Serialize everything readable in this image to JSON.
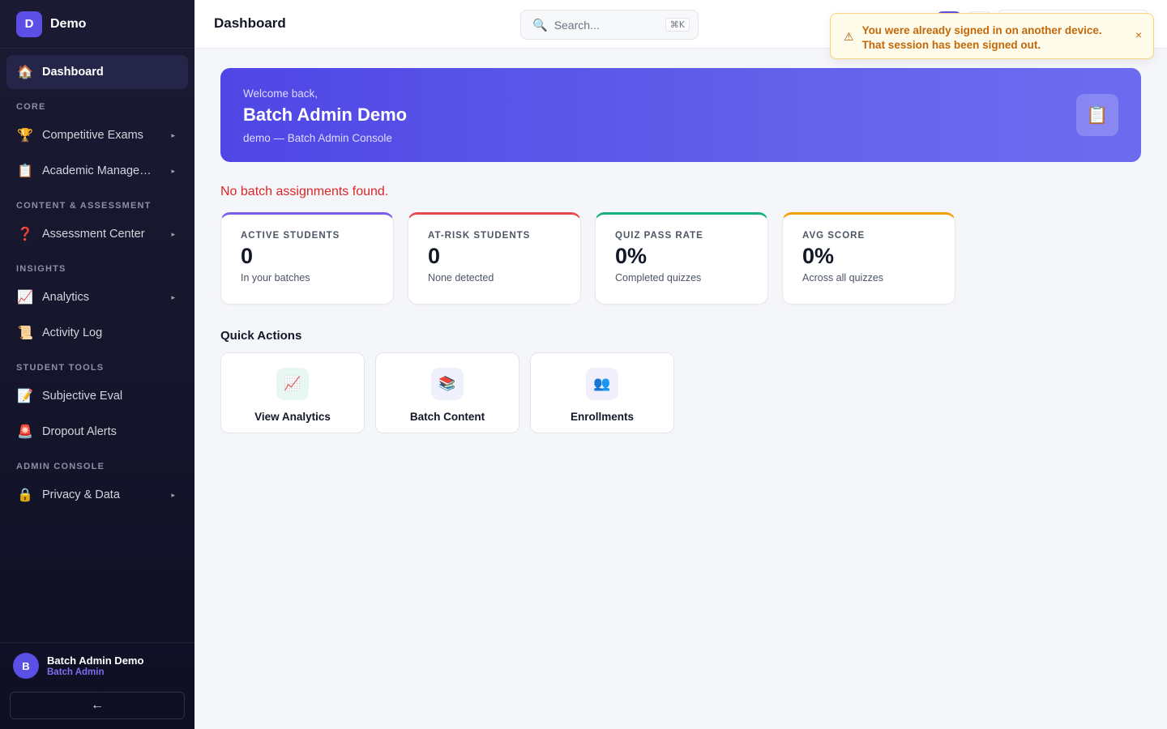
{
  "brand": {
    "logo_letter": "D",
    "name": "Demo"
  },
  "sidebar": {
    "dashboard": {
      "icon": "🏠",
      "label": "Dashboard"
    },
    "sections": {
      "core": "CORE",
      "content": "CONTENT & ASSESSMENT",
      "insights": "INSIGHTS",
      "student_tools": "STUDENT TOOLS",
      "admin_console": "ADMIN CONSOLE"
    },
    "items": {
      "competitive_exams": {
        "icon": "🏆",
        "label": "Competitive Exams"
      },
      "academic_management": {
        "icon": "📋",
        "label": "Academic Management"
      },
      "assessment_center": {
        "icon": "❓",
        "label": "Assessment Center"
      },
      "analytics": {
        "icon": "📈",
        "label": "Analytics"
      },
      "activity_log": {
        "icon": "📜",
        "label": "Activity Log"
      },
      "subjective_eval": {
        "icon": "📝",
        "label": "Subjective Eval"
      },
      "dropout_alerts": {
        "icon": "🚨",
        "label": "Dropout Alerts"
      },
      "privacy_data": {
        "icon": "🔒",
        "label": "Privacy & Data"
      }
    },
    "caret": "▸",
    "user": {
      "initial": "B",
      "name": "Batch Admin Demo",
      "role": "Batch Admin"
    },
    "collapse_icon": "←"
  },
  "header": {
    "title": "Dashboard",
    "search": {
      "icon": "🔍",
      "placeholder": "Search...",
      "shortcut": "⌘K"
    }
  },
  "toast": {
    "icon": "⚠",
    "message": "You were already signed in on another device. That session has been signed out.",
    "close": "×",
    "color": "#c2680a"
  },
  "hero": {
    "greeting": "Welcome back,",
    "name": "Batch Admin Demo",
    "subtitle": "demo — Batch Admin Console",
    "icon": "📋"
  },
  "error_message": "No batch assignments found.",
  "stats": [
    {
      "label": "ACTIVE STUDENTS",
      "value": "0",
      "hint": "In your batches",
      "accent": "#7c5ce6"
    },
    {
      "label": "AT-RISK STUDENTS",
      "value": "0",
      "hint": "None detected",
      "accent": "#e5484d"
    },
    {
      "label": "QUIZ PASS RATE",
      "value": "0%",
      "hint": "Completed quizzes",
      "accent": "#16b07c"
    },
    {
      "label": "AVG SCORE",
      "value": "0%",
      "hint": "Across all quizzes",
      "accent": "#f59e0b"
    }
  ],
  "quick_actions": {
    "title": "Quick Actions",
    "items": [
      {
        "icon": "📈",
        "label": "View Analytics",
        "tint": "#e8f7f1"
      },
      {
        "icon": "📚",
        "label": "Batch Content",
        "tint": "#eef0fb"
      },
      {
        "icon": "👥",
        "label": "Enrollments",
        "tint": "#f1effc"
      }
    ]
  }
}
